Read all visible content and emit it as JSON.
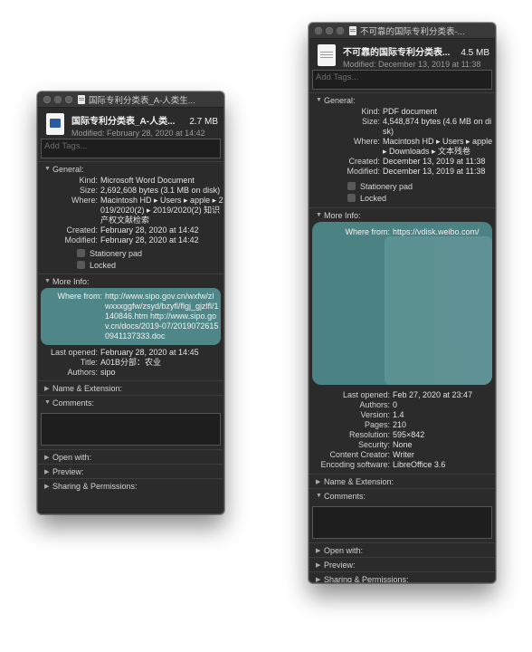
{
  "win1": {
    "title": "国际专利分类表_A-人类生...",
    "name": "国际专利分类表_A-人类...",
    "size": "2.7 MB",
    "modified": "Modified: February 28, 2020 at 14:42",
    "tags_placeholder": "Add Tags...",
    "general_label": "General:",
    "general": [
      {
        "k": "Kind:",
        "v": "Microsoft Word Document"
      },
      {
        "k": "Size:",
        "v": "2,692,608 bytes (3.1 MB on disk)"
      },
      {
        "k": "Where:",
        "v": "Macintosh HD ▸ Users ▸ apple ▸ 2019/2020(2) ▸ 2019/2020(2) 知识产权文献检索"
      },
      {
        "k": "Created:",
        "v": "February 28, 2020 at 14:42"
      },
      {
        "k": "Modified:",
        "v": "February 28, 2020 at 14:42"
      }
    ],
    "stationery": "Stationery pad",
    "locked": "Locked",
    "more_label": "More Info:",
    "where_from_k": "Where from:",
    "where_from_v": "http://www.sipo.gov.cn/wxfw/zlwxxxggfw/zsyd/bzyfl/flgj_gjzlfl/1140846.htm http://www.sipo.gov.cn/docs/2019-07/20190726150941137333.doc",
    "more": [
      {
        "k": "Last opened:",
        "v": "February 28, 2020 at 14:45"
      },
      {
        "k": "Title:",
        "v": "A01B分部：农业"
      },
      {
        "k": "Authors:",
        "v": "sipo"
      }
    ],
    "name_ext": "Name & Extension:",
    "comments": "Comments:",
    "open_with": "Open with:",
    "preview": "Preview:",
    "sharing": "Sharing & Permissions:"
  },
  "win2": {
    "title": "不可靠的国际专利分类表-...",
    "name": "不可靠的国际专利分类表...",
    "size": "4.5 MB",
    "modified": "Modified: December 13, 2019 at 11:38",
    "tags_placeholder": "Add Tags...",
    "general_label": "General:",
    "general": [
      {
        "k": "Kind:",
        "v": "PDF document"
      },
      {
        "k": "Size:",
        "v": "4,548,874 bytes (4.6 MB on disk)"
      },
      {
        "k": "Where:",
        "v": "Macintosh HD ▸ Users ▸ apple ▸ Downloads ▸ 文本残卷"
      },
      {
        "k": "Created:",
        "v": "December 13, 2019 at 11:38"
      },
      {
        "k": "Modified:",
        "v": "December 13, 2019 at 11:38"
      }
    ],
    "stationery": "Stationery pad",
    "locked": "Locked",
    "more_label": "More Info:",
    "where_from_k": "Where from:",
    "where_from_v": "https://vdisk.weibo.com/",
    "more": [
      {
        "k": "Last opened:",
        "v": "Feb 27, 2020 at 23:47"
      },
      {
        "k": "Authors:",
        "v": "0"
      },
      {
        "k": "Version:",
        "v": "1.4"
      },
      {
        "k": "Pages:",
        "v": "210"
      },
      {
        "k": "Resolution:",
        "v": "595×842"
      },
      {
        "k": "Security:",
        "v": "None"
      },
      {
        "k": "Content Creator:",
        "v": "Writer"
      },
      {
        "k": "Encoding software:",
        "v": "LibreOffice 3.6"
      }
    ],
    "name_ext": "Name & Extension:",
    "comments": "Comments:",
    "open_with": "Open with:",
    "preview": "Preview:",
    "sharing": "Sharing & Permissions:"
  }
}
